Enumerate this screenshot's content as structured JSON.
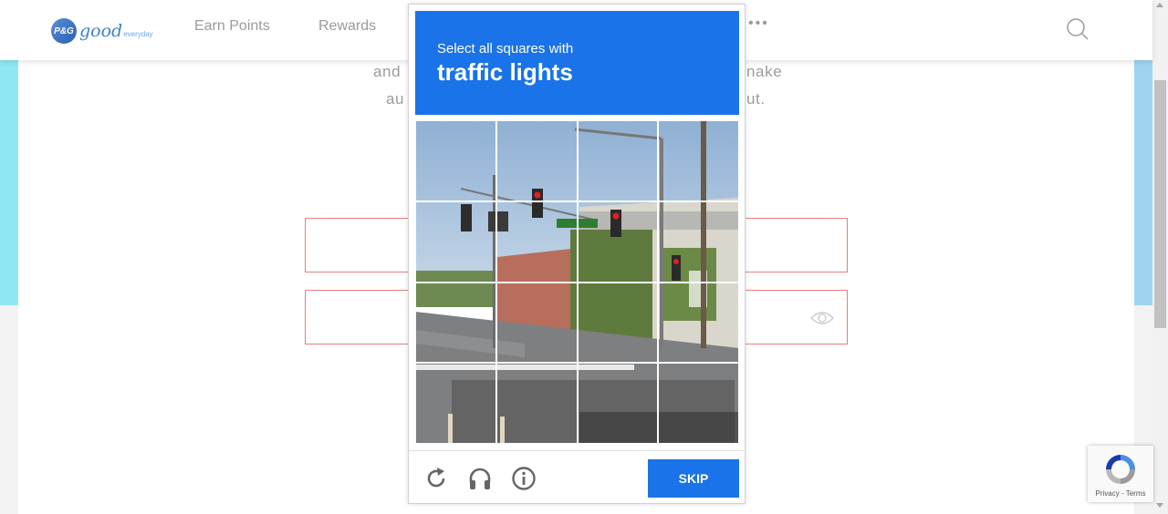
{
  "header": {
    "logo": {
      "brand": "P&G",
      "good": "good",
      "everyday": "everyday"
    },
    "nav": {
      "earn_points": "Earn Points",
      "rewards": "Rewards",
      "more": "•••"
    }
  },
  "page": {
    "intro_line1_left": "and",
    "intro_line1_right": "nake",
    "intro_line2_left": "au",
    "intro_line2_right": "ut."
  },
  "captcha": {
    "prompt": "Select all squares with",
    "target": "traffic lights",
    "skip_label": "SKIP"
  },
  "badge": {
    "links": "Privacy - Terms"
  },
  "colors": {
    "accent": "#1a73e8",
    "field_border": "#e87e7e",
    "left_band": "#8ee8f2",
    "right_band": "#9fd4f0"
  },
  "icons": [
    "search-icon",
    "eye-icon",
    "reload-icon",
    "headphones-icon",
    "info-icon",
    "recaptcha-logo"
  ]
}
